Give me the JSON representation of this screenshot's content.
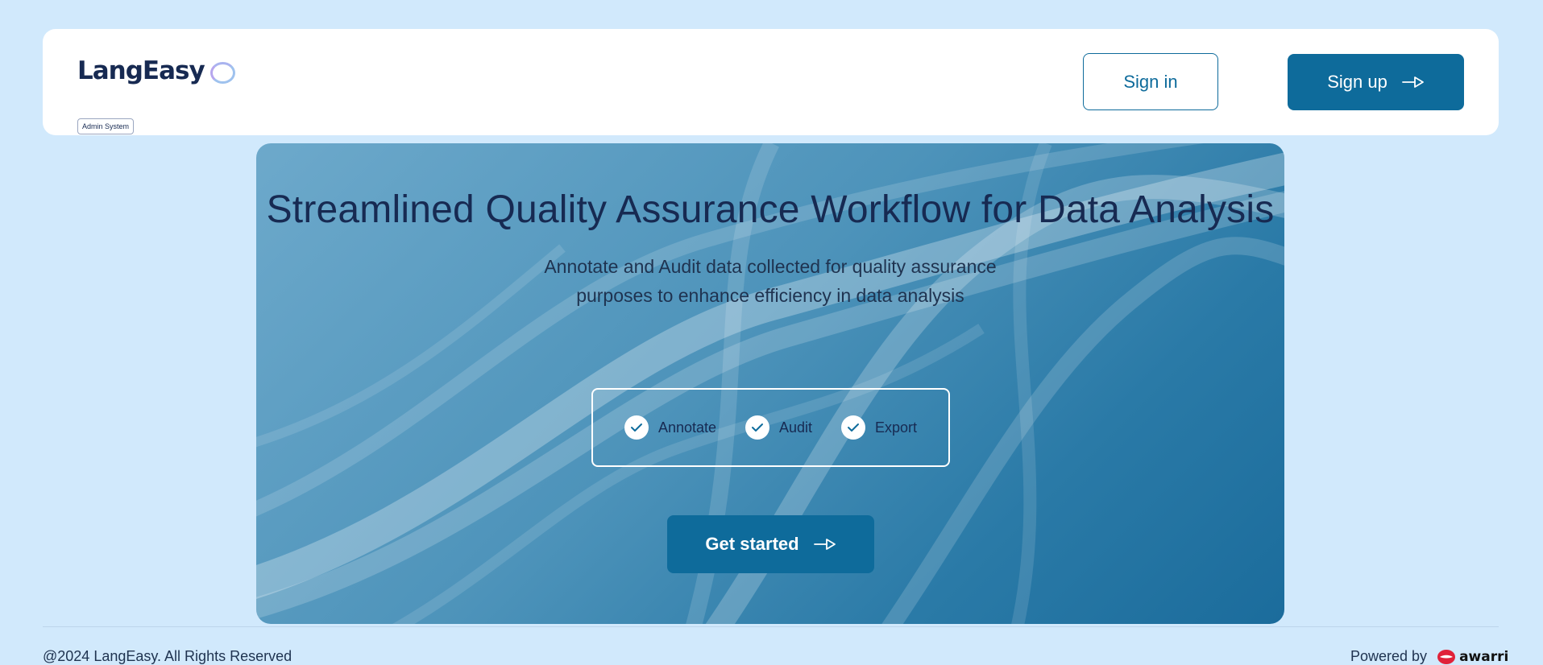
{
  "header": {
    "logo_text": "LangEasy",
    "logo_badge": "Admin System",
    "signin_label": "Sign in",
    "signup_label": "Sign up"
  },
  "hero": {
    "title": "Streamlined Quality Assurance Workflow for Data Analysis",
    "subtitle": "Annotate and Audit data collected for quality assurance purposes to enhance efficiency in data analysis",
    "features": [
      {
        "label": "Annotate"
      },
      {
        "label": "Audit"
      },
      {
        "label": "Export"
      }
    ],
    "cta_label": "Get started"
  },
  "footer": {
    "copyright": "@2024 LangEasy. All Rights Reserved",
    "powered_by_label": "Powered by",
    "brand_name": "awarri"
  },
  "colors": {
    "page_background": "#d1e9fc",
    "primary": "#0e6b9b",
    "heading": "#172a52",
    "brand_red": "#e0223a"
  },
  "icons": {
    "arrow": "arrow-right-icon",
    "check": "check-icon",
    "logo_mark": "ring-icon",
    "brand_mark": "awarri-lips-icon"
  }
}
